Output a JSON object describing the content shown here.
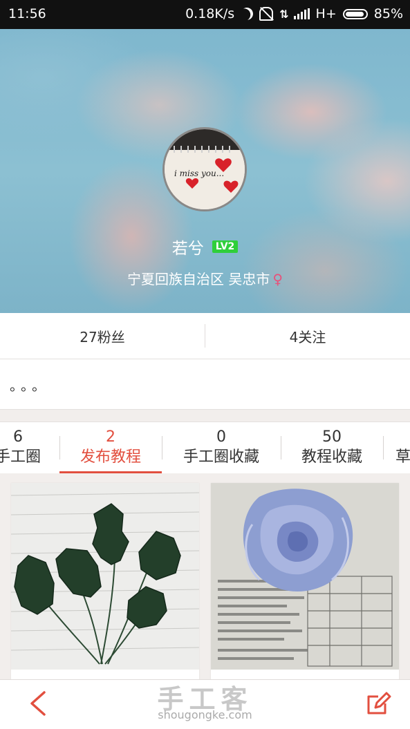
{
  "status_bar": {
    "time": "11:56",
    "speed": "0.18K/s",
    "network": "H+",
    "battery": "85%",
    "icons": [
      "moon-icon",
      "mute-bell-icon",
      "data-transfer-icon",
      "signal-icon",
      "battery-icon"
    ]
  },
  "profile": {
    "avatar_text": "i miss you...",
    "name": "若兮",
    "level": "LV2",
    "location": "宁夏回族自治区 吴忠市",
    "gender_symbol": "♀"
  },
  "stats": {
    "fans": "27粉丝",
    "following": "4关注"
  },
  "signature": "。。。",
  "tabs": [
    {
      "count": "6",
      "label": "手工圈"
    },
    {
      "count": "2",
      "label": "发布教程",
      "active": true
    },
    {
      "count": "0",
      "label": "手工圈收藏"
    },
    {
      "count": "50",
      "label": "教程收藏"
    },
    {
      "count": "",
      "label": "草"
    }
  ],
  "bottom_bar": {
    "logo": "手工客",
    "logo_domain": "shougongke.com"
  },
  "colors": {
    "accent": "#e24f3f",
    "level_badge": "#2fcf3a",
    "female": "#e8517a",
    "status_bar_bg": "#111111"
  }
}
